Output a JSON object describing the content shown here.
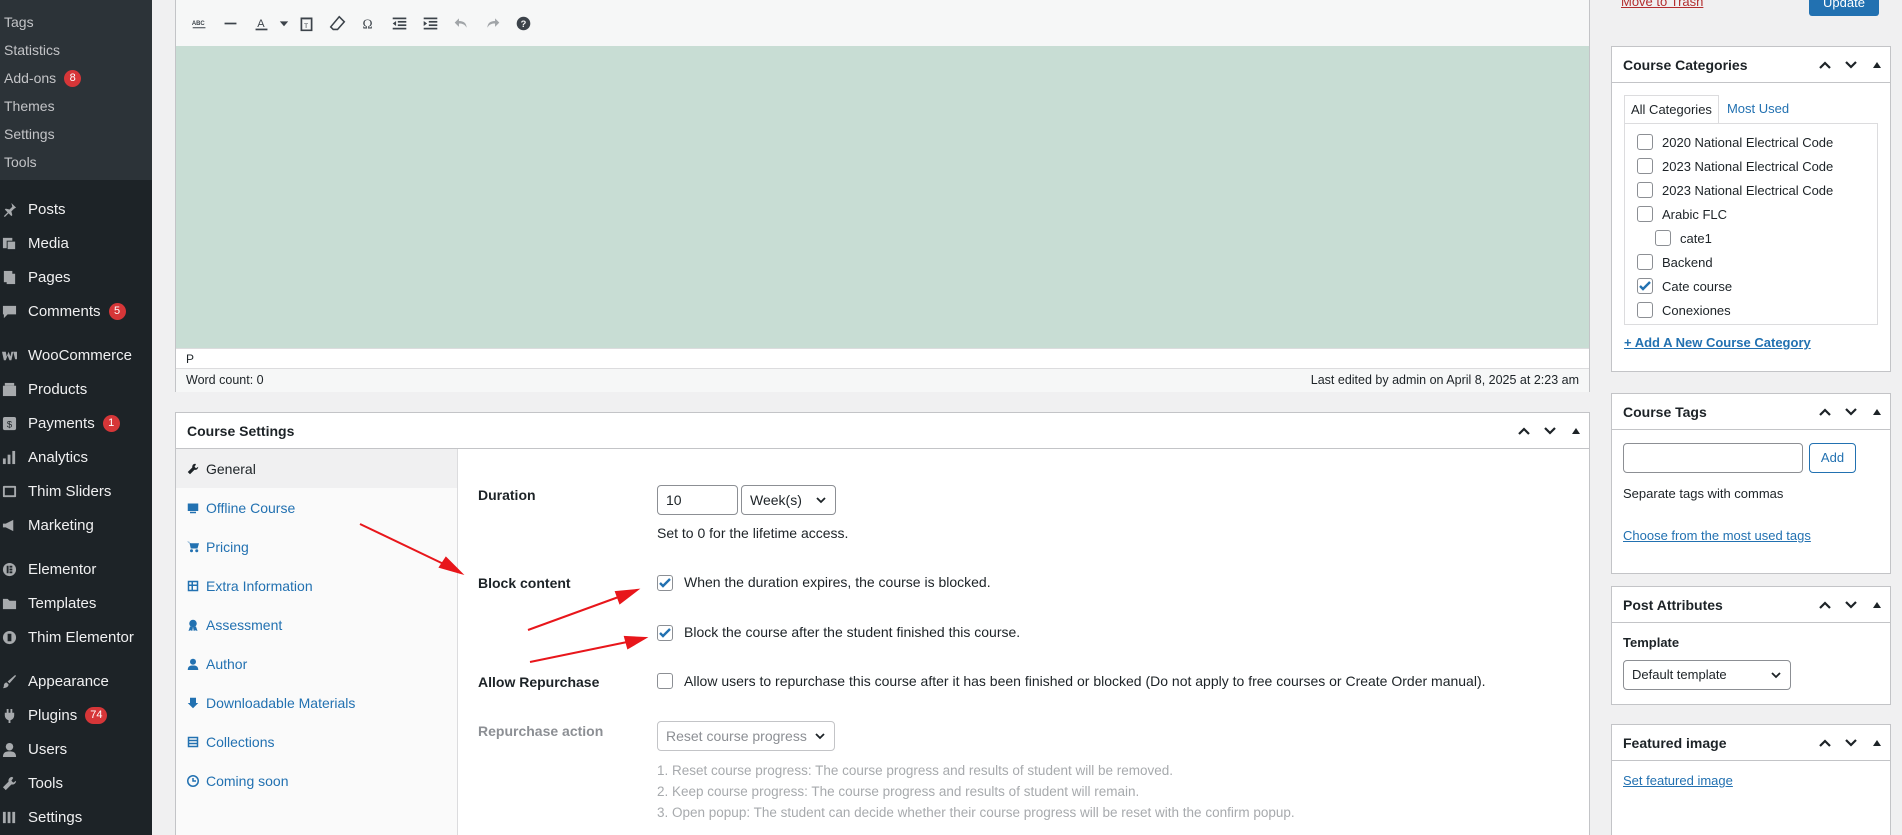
{
  "sidebar": {
    "submenu": [
      "Tags",
      "Statistics",
      "Add-ons",
      "Themes",
      "Settings",
      "Tools"
    ],
    "addons_badge": "8",
    "menu": [
      {
        "label": "Posts",
        "icon": "pin-icon"
      },
      {
        "label": "Media",
        "icon": "media-icon"
      },
      {
        "label": "Pages",
        "icon": "pages-icon"
      },
      {
        "label": "Comments",
        "icon": "comments-icon",
        "badge": "5"
      },
      {
        "label": "WooCommerce",
        "icon": "woocommerce-icon"
      },
      {
        "label": "Products",
        "icon": "products-icon"
      },
      {
        "label": "Payments",
        "icon": "payments-icon",
        "badge": "1"
      },
      {
        "label": "Analytics",
        "icon": "analytics-icon"
      },
      {
        "label": "Thim Sliders",
        "icon": "slider-icon"
      },
      {
        "label": "Marketing",
        "icon": "megaphone-icon"
      },
      {
        "label": "Elementor",
        "icon": "elementor-icon"
      },
      {
        "label": "Templates",
        "icon": "folder-icon"
      },
      {
        "label": "Thim Elementor",
        "icon": "thim-icon"
      },
      {
        "label": "Appearance",
        "icon": "brush-icon"
      },
      {
        "label": "Plugins",
        "icon": "plugin-icon",
        "badge": "74"
      },
      {
        "label": "Users",
        "icon": "user-icon"
      },
      {
        "label": "Tools",
        "icon": "wrench-icon"
      },
      {
        "label": "Settings",
        "icon": "settings-icon"
      }
    ]
  },
  "editor": {
    "path": "P",
    "word_count": "Word count: 0",
    "last_edited": "Last edited by admin on April 8, 2025 at 2:23 am"
  },
  "course_settings": {
    "title": "Course Settings",
    "tabs": [
      "General",
      "Offline Course",
      "Pricing",
      "Extra Information",
      "Assessment",
      "Author",
      "Downloadable Materials",
      "Collections",
      "Coming soon"
    ],
    "duration": {
      "label": "Duration",
      "value": "10",
      "unit": "Week(s)",
      "hint": "Set to 0 for the lifetime access."
    },
    "block_content": {
      "label": "Block content",
      "option1": "When the duration expires, the course is blocked.",
      "option2": "Block the course after the student finished this course."
    },
    "allow_repurchase": {
      "label": "Allow Repurchase",
      "text": "Allow users to repurchase this course after it has been finished or blocked (Do not apply to free courses or Create Order manual)."
    },
    "repurchase_action": {
      "label": "Repurchase action",
      "value": "Reset course progress",
      "notes": [
        "1. Reset course progress: The course progress and results of student will be removed.",
        "2. Keep course progress: The course progress and results of student will remain.",
        "3. Open popup: The student can decide whether their course progress will be reset with the confirm popup."
      ]
    }
  },
  "publish": {
    "trash": "Move to Trash",
    "update": "Update"
  },
  "categories": {
    "title": "Course Categories",
    "tab_all": "All Categories",
    "tab_used": "Most Used",
    "items": [
      {
        "label": "2020 National Electrical Code",
        "checked": false
      },
      {
        "label": "2023 National Electrical Code",
        "checked": false
      },
      {
        "label": "2023 National Electrical Code",
        "checked": false
      },
      {
        "label": "Arabic FLC",
        "checked": false
      },
      {
        "label": "cate1",
        "checked": false,
        "child": true
      },
      {
        "label": "Backend",
        "checked": false
      },
      {
        "label": "Cate course",
        "checked": true
      },
      {
        "label": "Conexiones",
        "checked": false
      }
    ],
    "add_new": "+ Add A New Course Category"
  },
  "tags": {
    "title": "Course Tags",
    "add": "Add",
    "hint": "Separate tags with commas",
    "choose": "Choose from the most used tags"
  },
  "attributes": {
    "title": "Post Attributes",
    "template_label": "Template",
    "template_value": "Default template"
  },
  "featured": {
    "title": "Featured image",
    "set": "Set featured image"
  },
  "colors": {
    "accent": "#2271b1",
    "annotation_arrow": "#e8161b",
    "editor_bg": "#c8ddd4"
  }
}
